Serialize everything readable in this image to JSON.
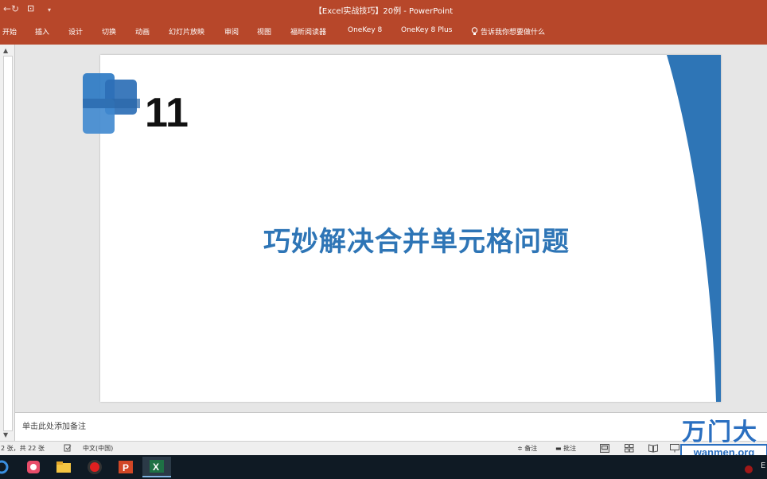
{
  "window": {
    "title": "【Excel实战技巧】20例  -  PowerPoint"
  },
  "ribbon": {
    "tabs": [
      "开始",
      "插入",
      "设计",
      "切换",
      "动画",
      "幻灯片放映",
      "审阅",
      "视图",
      "福昕阅读器",
      "OneKey 8",
      "OneKey 8 Plus"
    ],
    "tell_me": "告诉我你想要做什么"
  },
  "slide": {
    "number": "11",
    "title": "巧妙解决合并单元格问题",
    "accent_color": "#2e75b6"
  },
  "notes": {
    "placeholder": "单击此处添加备注"
  },
  "statusbar": {
    "slide_count": "2 张，共 22 张",
    "language": "中文(中国)",
    "notes_btn": "备注",
    "comments_btn": "批注"
  },
  "watermark": {
    "brand_chars": "万门大",
    "url": "wanmen.org"
  },
  "taskbar": {
    "apps": [
      "camera-app-icon",
      "file-explorer-icon",
      "recorder-icon",
      "powerpoint-icon",
      "excel-icon"
    ],
    "tray_text": "E"
  },
  "colors": {
    "title_bar": "#b7472a",
    "slide_accent": "#2e75b6"
  }
}
